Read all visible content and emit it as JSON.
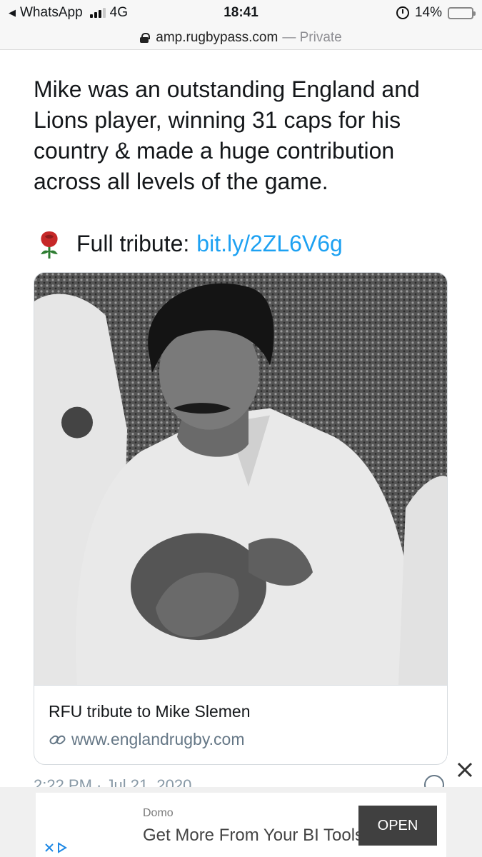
{
  "status_bar": {
    "back_app": "WhatsApp",
    "network": "4G",
    "time": "18:41",
    "battery_percent": "14%",
    "battery_level": 0.14
  },
  "url_bar": {
    "host": "amp.rugbypass.com",
    "mode": "— Private"
  },
  "tweet": {
    "text": "Mike was an outstanding England and Lions player, winning 31 caps for his country & made a huge contribution across all levels of the game.",
    "tribute_label": "Full tribute:",
    "tribute_link": "bit.ly/2ZL6V6g",
    "timestamp": "2:22 PM · Jul 21, 2020"
  },
  "card": {
    "image_icon": "photo-rugby-player",
    "title": "RFU tribute to Mike Slemen",
    "url": "www.englandrugby.com"
  },
  "ad": {
    "brand": "Domo",
    "headline": "Get More From Your BI Tools",
    "cta": "OPEN"
  },
  "colors": {
    "link": "#1da1f2",
    "text": "#14171a",
    "muted": "#657786",
    "ad_button": "#404040",
    "battery": "#f5c400"
  }
}
